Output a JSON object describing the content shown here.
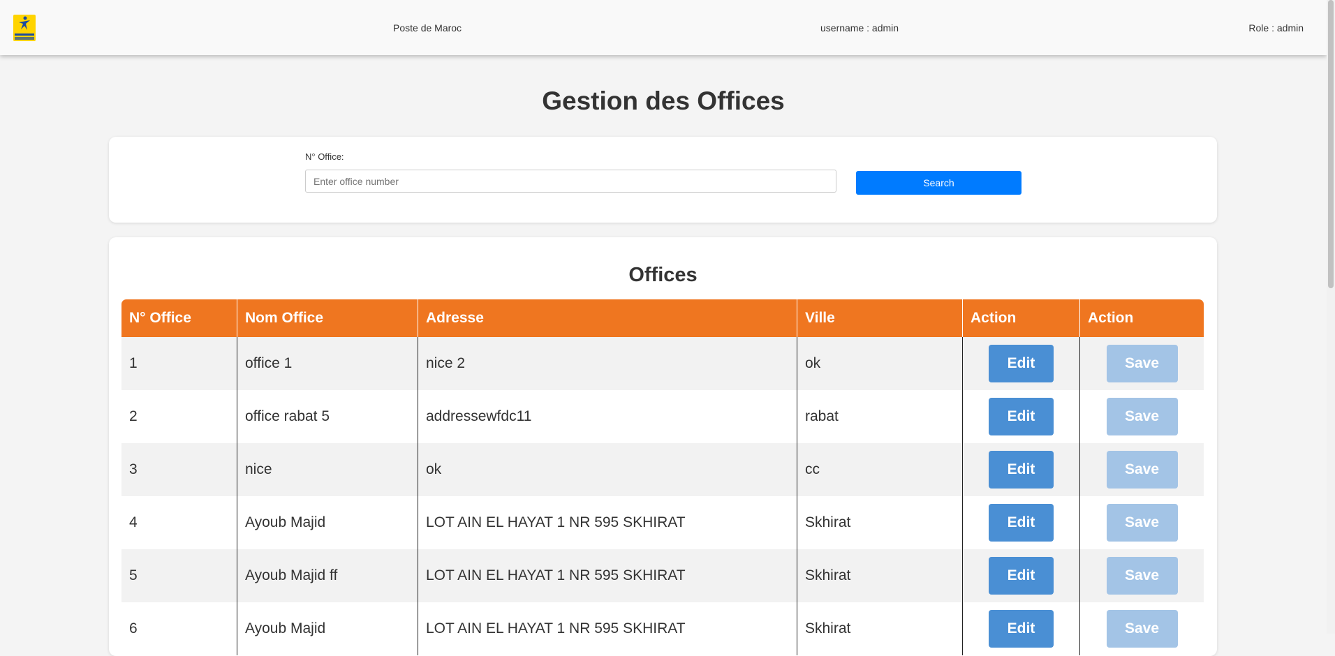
{
  "navbar": {
    "brand": "Poste de Maroc",
    "username": "username : admin",
    "role": "Role : admin",
    "logo_icon": "poste-maroc-logo"
  },
  "page": {
    "title": "Gestion des Offices"
  },
  "search": {
    "label": "N° Office:",
    "placeholder": "Enter office number",
    "value": "",
    "button_label": "Search"
  },
  "offices": {
    "title": "Offices",
    "columns": [
      "N° Office",
      "Nom Office",
      "Adresse",
      "Ville",
      "Action",
      "Action"
    ],
    "edit_label": "Edit",
    "save_label": "Save",
    "rows": [
      {
        "id": "1",
        "nom": "office 1",
        "adresse": "nice 2",
        "ville": "ok"
      },
      {
        "id": "2",
        "nom": "office rabat 5",
        "adresse": "addressewfdc11",
        "ville": "rabat"
      },
      {
        "id": "3",
        "nom": "nice",
        "adresse": "ok",
        "ville": "cc"
      },
      {
        "id": "4",
        "nom": "Ayoub Majid",
        "adresse": "LOT AIN EL HAYAT 1 NR 595 SKHIRAT",
        "ville": "Skhirat"
      },
      {
        "id": "5",
        "nom": "Ayoub Majid ff",
        "adresse": "LOT AIN EL HAYAT 1 NR 595 SKHIRAT",
        "ville": "Skhirat"
      },
      {
        "id": "6",
        "nom": "Ayoub Majid",
        "adresse": "LOT AIN EL HAYAT 1 NR 595 SKHIRAT",
        "ville": "Skhirat"
      }
    ]
  },
  "colors": {
    "header_orange": "#ef7620",
    "edit_blue": "#4a8fd4",
    "save_disabled_blue": "#a3c4e6",
    "search_blue": "#007bff"
  }
}
